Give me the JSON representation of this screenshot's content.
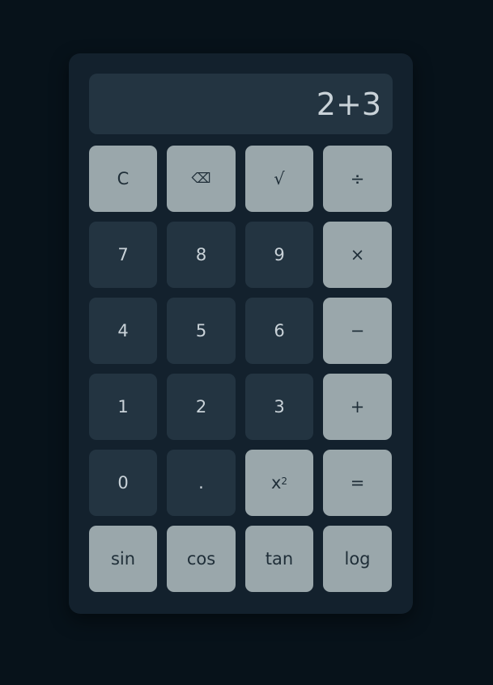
{
  "display": {
    "value": "2+3"
  },
  "keys": {
    "clear": "C",
    "backspace": "⌫",
    "sqrt": "√",
    "divide": "÷",
    "seven": "7",
    "eight": "8",
    "nine": "9",
    "multiply": "×",
    "four": "4",
    "five": "5",
    "six": "6",
    "minus": "−",
    "one": "1",
    "two": "2",
    "three": "3",
    "plus": "+",
    "zero": "0",
    "decimal": ".",
    "square_base": "x",
    "square_exp": "2",
    "equals": "=",
    "sin": "sin",
    "cos": "cos",
    "tan": "tan",
    "log": "log"
  },
  "colors": {
    "background": "#07121a",
    "body": "#13212d",
    "display": "#233441",
    "key_light": "#9aa7ab",
    "key_dark": "#233441",
    "text_light": "#c9d2d8",
    "text_dark": "#1f2e38"
  }
}
